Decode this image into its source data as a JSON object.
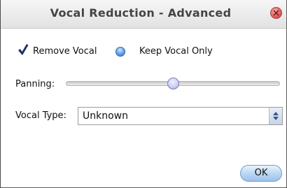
{
  "dialog": {
    "title": "Vocal Reduction - Advanced"
  },
  "options": {
    "remove_vocal_label": "Remove Vocal",
    "remove_vocal_checked": true,
    "keep_vocal_only_label": "Keep Vocal Only",
    "keep_vocal_only_selected": false
  },
  "panning": {
    "label": "Panning:",
    "value_fraction": 0.5
  },
  "vocal_type": {
    "label": "Vocal Type:",
    "selected": "Unknown"
  },
  "buttons": {
    "ok_label": "OK"
  },
  "icons": {
    "close": "close-icon",
    "checkmark": "checkmark-icon",
    "select_arrows": "up-down-arrows-icon"
  },
  "colors": {
    "close_button": "#e05a5a",
    "radio_accent": "#5d9fe8",
    "ok_button": "#b9d5f2"
  }
}
